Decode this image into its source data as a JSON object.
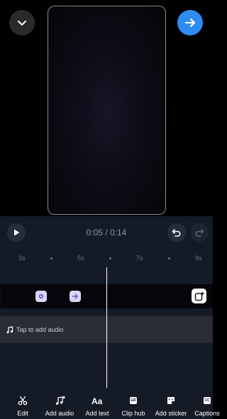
{
  "header": {
    "collapse_icon": "chevron-down-icon",
    "next_icon": "arrow-right-icon",
    "accent_color": "#2e8bf0"
  },
  "player": {
    "time_display": "0:05 / 0:14",
    "play_icon": "play-icon",
    "undo_icon": "undo-icon",
    "redo_icon": "redo-icon"
  },
  "timeline": {
    "ticks": [
      "3s",
      "5s",
      "7s",
      "9s"
    ],
    "add_clip_icon": "add-clip-icon",
    "transition_icons": [
      "transition-icon",
      "transition-icon"
    ]
  },
  "audio": {
    "label": "Tap to add audio",
    "icon": "music-note-icon"
  },
  "toolbar": {
    "items": [
      {
        "label": "Edit",
        "icon": "scissors-icon"
      },
      {
        "label": "Add audio",
        "icon": "music-plus-icon"
      },
      {
        "label": "Add text",
        "icon": "text-aa-icon"
      },
      {
        "label": "Clip hub",
        "icon": "gif-icon",
        "badge": "GIF"
      },
      {
        "label": "Add sticker",
        "icon": "sticker-icon"
      },
      {
        "label": "Captions",
        "icon": "captions-icon",
        "badge": "CC"
      }
    ]
  }
}
